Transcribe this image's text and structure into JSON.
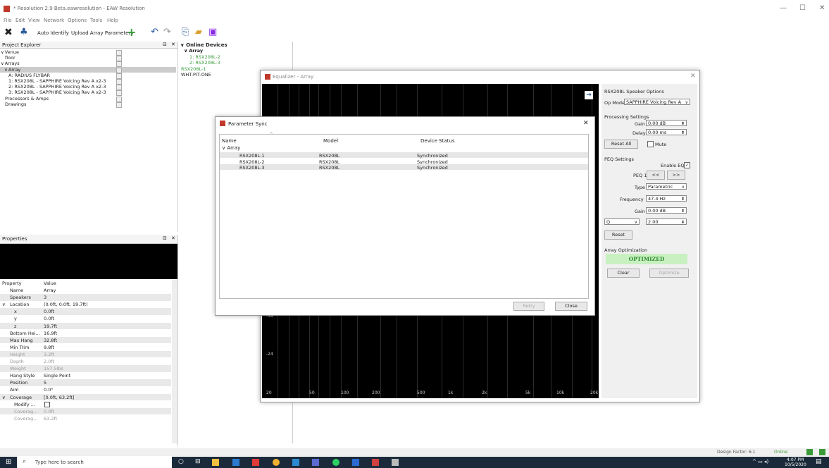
{
  "window": {
    "title": "* Resolution 2.9 Beta.eawresolution - EAW Resolution",
    "minimize": "—",
    "maximize": "☐",
    "close": "✕"
  },
  "menu": [
    "File",
    "Edit",
    "View",
    "Network",
    "Options",
    "Tools",
    "Help"
  ],
  "toolbar": {
    "auto_identify": "Auto Identify",
    "upload_array": "Upload Array Parameters"
  },
  "project_explorer": {
    "title": "Project Explorer",
    "items": [
      {
        "text": "Venue",
        "indent": 0,
        "expander": "∨"
      },
      {
        "text": "floor",
        "indent": 1
      },
      {
        "text": "Arrays",
        "indent": 0,
        "expander": "∨"
      },
      {
        "text": "Array",
        "indent": 1,
        "expander": "∨",
        "selected": true
      },
      {
        "text": "A: RADIUS FLYBAR",
        "indent": 2
      },
      {
        "text": "1: RSX208L - SAPPHIRE Voicing Rev A x2-3",
        "indent": 2
      },
      {
        "text": "2: RSX208L - SAPPHIRE Voicing Rev A x2-3",
        "indent": 2
      },
      {
        "text": "3: RSX208L - SAPPHIRE Voicing Rev A x2-3",
        "indent": 2
      },
      {
        "text": "Processors & Amps",
        "indent": 1
      },
      {
        "text": "Drawings",
        "indent": 1
      }
    ]
  },
  "online_devices": {
    "title": "Online Devices",
    "items": [
      {
        "text": "Array",
        "bold": true,
        "expander": "∨"
      },
      {
        "text": "1: RSX208L-2",
        "color": "green"
      },
      {
        "text": "2: RSX208L-3",
        "color": "green"
      },
      {
        "text": "RSX208L-1",
        "color": "green"
      },
      {
        "text": "WHT-PIT-ONE",
        "color": "black"
      }
    ]
  },
  "properties": {
    "title": "Properties",
    "col_property": "Property",
    "col_value": "Value",
    "rows": [
      {
        "k": "Name",
        "v": "Array"
      },
      {
        "k": "Speakers",
        "v": "3"
      },
      {
        "k": "Location",
        "v": "(0.0ft, 0.0ft, 19.7ft)",
        "expander": "∨"
      },
      {
        "k": "x",
        "v": "0.0ft",
        "sub": true
      },
      {
        "k": "y",
        "v": "0.0ft",
        "sub": true
      },
      {
        "k": "z",
        "v": "19.7ft",
        "sub": true
      },
      {
        "k": "Bottom Hei...",
        "v": "16.9ft"
      },
      {
        "k": "Max Hang",
        "v": "32.8ft"
      },
      {
        "k": "Min Trim",
        "v": "9.8ft"
      },
      {
        "k": "Height",
        "v": "3.2ft",
        "dim": true
      },
      {
        "k": "Depth",
        "v": "2.0ft",
        "dim": true
      },
      {
        "k": "Weight",
        "v": "157.5lbs",
        "dim": true
      },
      {
        "k": "Hang Style",
        "v": "Single Point"
      },
      {
        "k": "Position",
        "v": "5"
      },
      {
        "k": "Aim",
        "v": "0.0°"
      },
      {
        "k": "Coverage",
        "v": "[0.0ft, 63.2ft]",
        "expander": "∨"
      },
      {
        "k": "Modify ...",
        "v": "",
        "sub": true,
        "checkbox": true
      },
      {
        "k": "Coverag...",
        "v": "0.0ft",
        "sub": true,
        "dim": true
      },
      {
        "k": "Coverag...",
        "v": "63.2ft",
        "sub": true,
        "dim": true
      }
    ]
  },
  "equalizer": {
    "title": "Equalizer - Array",
    "y_labels": [
      "-18",
      "-24"
    ],
    "x_labels": [
      "20",
      "50",
      "100",
      "200",
      "500",
      "1k",
      "2k",
      "5k",
      "10k",
      "20k"
    ],
    "speaker_options": "RSX208L Speaker Options",
    "op_mode_label": "Op Mode",
    "op_mode_value": "SAPPHIRE Voicing Rev A",
    "processing_settings": "Processing Settings",
    "gain_label": "Gain",
    "gain_value": "0.00 dB",
    "delay_label": "Delay",
    "delay_value": "0.00 ms",
    "reset_all": "Reset All",
    "mute": "Mute",
    "peq_settings": "PEQ Settings",
    "enable_eq": "Enable EQ",
    "peq_label": "PEQ 1",
    "prev": "<<",
    "next": ">>",
    "type_label": "Type",
    "type_value": "Parametric",
    "frequency_label": "Frequency",
    "frequency_value": "47.4 Hz",
    "peq_gain_label": "Gain",
    "peq_gain_value": "0.00 dB",
    "q_select": "Q",
    "q_value": "2.00",
    "reset": "Reset",
    "array_optimization": "Array Optimization",
    "optimized": "OPTIMIZED",
    "clear": "Clear",
    "optimize": "Optimize"
  },
  "param_sync": {
    "title": "Parameter Sync",
    "col_name": "Name",
    "col_model": "Model",
    "col_status": "Device Status",
    "group": "Array",
    "rows": [
      {
        "name": "RSX208L-1",
        "model": "RSX208L",
        "status": "Synchronized"
      },
      {
        "name": "RSX208L-2",
        "model": "RSX208L",
        "status": "Synchronized"
      },
      {
        "name": "RSX208L-3",
        "model": "RSX208L",
        "status": "Synchronized"
      }
    ],
    "retry": "Retry",
    "close": "Close"
  },
  "statusbar": {
    "design_factor": "Design Factor: 6:1",
    "online": "Online"
  },
  "taskbar": {
    "search_placeholder": "Type here to search",
    "time": "4:07 PM",
    "date": "10/5/2020"
  },
  "colors": {
    "accent_green": "#3a9a3a",
    "optimized_bg": "#c8f0c0",
    "brand_red": "#c0392b"
  }
}
